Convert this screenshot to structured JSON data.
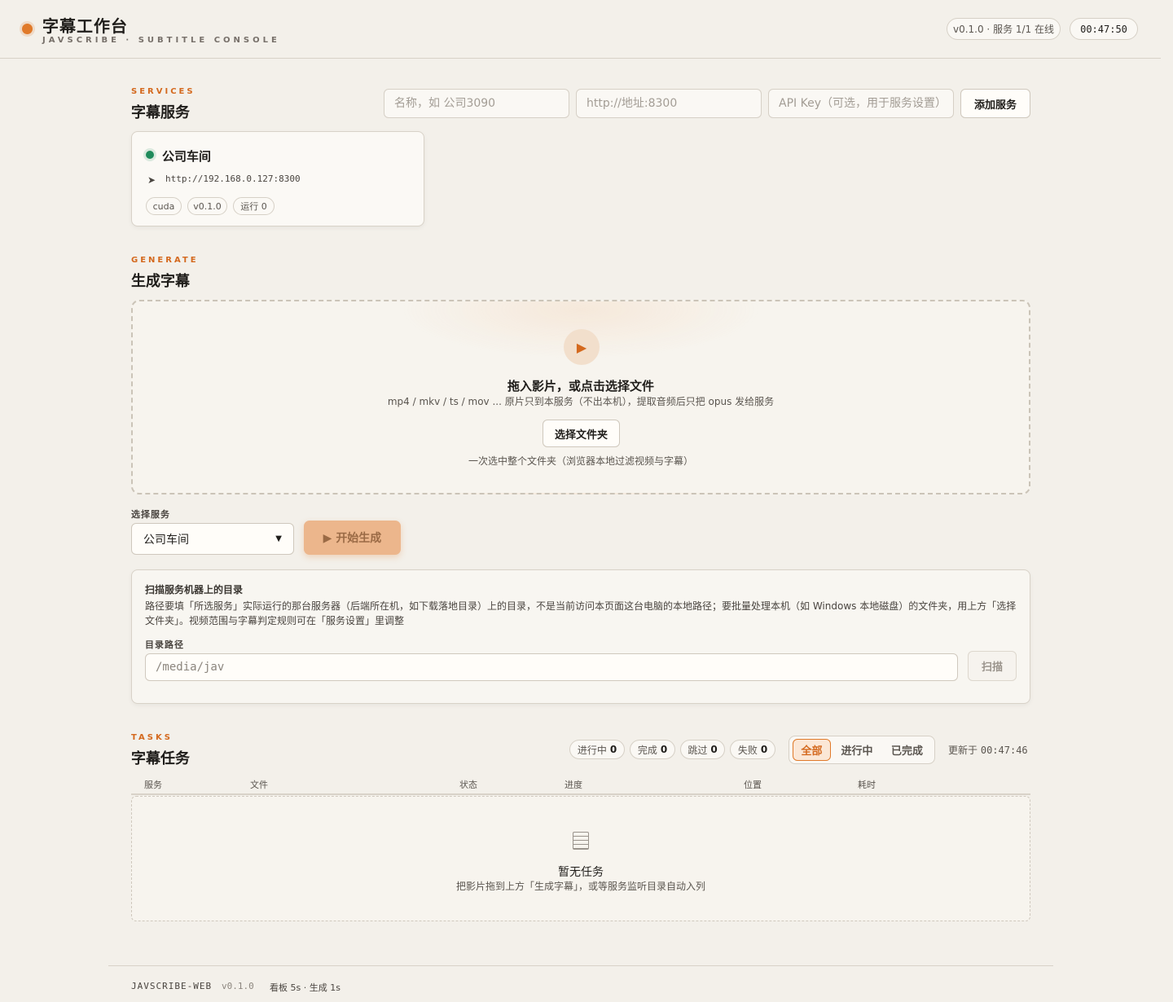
{
  "header": {
    "title": "字幕工作台",
    "subtitle": "JAVSCRIBE · SUBTITLE CONSOLE",
    "status_pill": "v0.1.0 · 服务 1/1 在线",
    "clock": "00:47:50"
  },
  "services": {
    "eyebrow": "SERVICES",
    "title": "字幕服务",
    "name_placeholder": "名称，如 公司3090",
    "url_placeholder": "http://地址:8300",
    "apikey_placeholder": "API Key（可选，用于服务设置）",
    "add_button": "添加服务",
    "cards": [
      {
        "name": "公司车间",
        "status": "online",
        "status_color": "#1f8a5b",
        "url": "http://192.168.0.127:8300",
        "tags": [
          "cuda",
          "v0.1.0",
          "运行 0"
        ]
      }
    ]
  },
  "generate": {
    "eyebrow": "GENERATE",
    "title": "生成字幕",
    "drop_title": "拖入影片，或点击选择文件",
    "drop_sub": "mp4 / mkv / ts / mov ... 原片只到本服务（不出本机），提取音频后只把 opus 发给服务",
    "folder_button": "选择文件夹",
    "folder_hint": "一次选中整个文件夹（浏览器本地过滤视频与字幕）",
    "service_label": "选择服务",
    "service_selected": "公司车间",
    "start_button": "▶ 开始生成",
    "accent_color": "#e07a2a"
  },
  "scan": {
    "title": "扫描服务机器上的目录",
    "description": "路径要填「所选服务」实际运行的那台服务器（后端所在机，如下载落地目录）上的目录，不是当前访问本页面这台电脑的本地路径；要批量处理本机（如 Windows 本地磁盘）的文件夹，用上方「选择文件夹」。视频范围与字幕判定规则可在「服务设置」里调整",
    "path_label": "目录路径",
    "path_placeholder": "/media/jav",
    "scan_button": "扫描"
  },
  "tasks": {
    "eyebrow": "TASKS",
    "title": "字幕任务",
    "counts": [
      {
        "label": "进行中",
        "value": "0"
      },
      {
        "label": "完成",
        "value": "0"
      },
      {
        "label": "跳过",
        "value": "0"
      },
      {
        "label": "失败",
        "value": "0"
      }
    ],
    "filters": [
      "全部",
      "进行中",
      "已完成"
    ],
    "active_filter": "全部",
    "updated_label": "更新于",
    "updated_time": "00:47:46",
    "columns": [
      "服务",
      "文件",
      "状态",
      "进度",
      "位置",
      "耗时"
    ],
    "empty_title": "暂无任务",
    "empty_sub": "把影片拖到上方「生成字幕」，或等服务监听目录自动入列"
  },
  "footer": {
    "app": "JAVSCRIBE-WEB",
    "version": "v0.1.0",
    "refresh": "看板 5s · 生成 1s"
  }
}
